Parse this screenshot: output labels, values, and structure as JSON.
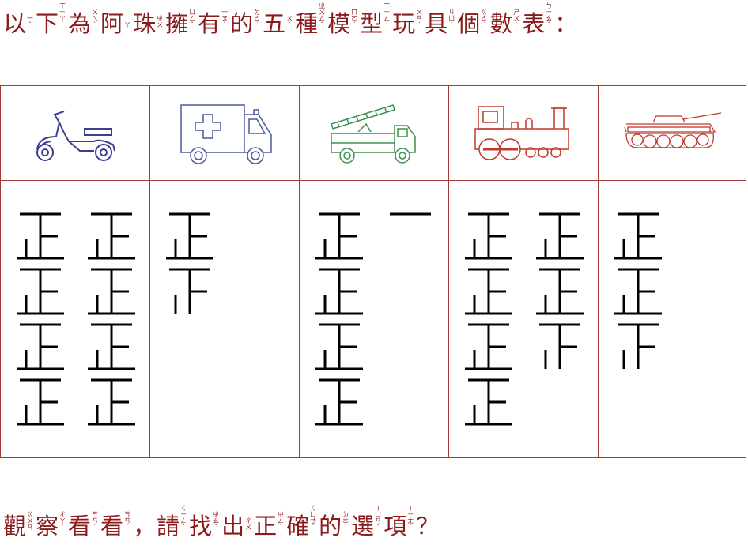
{
  "question_line": [
    {
      "char": "以",
      "bpmf": [
        "一",
        "ˇ"
      ]
    },
    {
      "char": "下",
      "bpmf": [
        "ㄒ",
        "ㄧ",
        "ㄚ",
        "ˋ"
      ]
    },
    {
      "char": "為",
      "bpmf": [
        "ㄨ",
        "ㄟ",
        "ˋ"
      ]
    },
    {
      "char": "阿",
      "bpmf": [
        "ㄚ"
      ]
    },
    {
      "char": "珠",
      "bpmf": [
        "ㄓ",
        "ㄨ"
      ]
    },
    {
      "char": "擁",
      "bpmf": [
        "ㄩ",
        "ㄥ",
        "ˇ"
      ]
    },
    {
      "char": "有",
      "bpmf": [
        "一",
        "ㄡ",
        "ˇ"
      ]
    },
    {
      "char": "的",
      "bpmf": [
        "ㄉ",
        "ㄜ",
        "˙"
      ]
    },
    {
      "char": "五",
      "bpmf": [
        "ㄨ",
        "ˇ"
      ]
    },
    {
      "char": "種",
      "bpmf": [
        "ㄓ",
        "ㄨ",
        "ㄥ",
        "ˇ"
      ]
    },
    {
      "char": "模",
      "bpmf": [
        "ㄇ",
        "ㄛ",
        "ˊ"
      ]
    },
    {
      "char": "型",
      "bpmf": [
        "ㄒ",
        "ㄧ",
        "ㄥ",
        "ˊ"
      ]
    },
    {
      "char": "玩",
      "bpmf": [
        "ㄨ",
        "ㄢ",
        "ˊ"
      ]
    },
    {
      "char": "具",
      "bpmf": [
        "ㄐ",
        "ㄩ",
        "ˋ"
      ]
    },
    {
      "char": "個",
      "bpmf": [
        "ㄍ",
        "ㄜ",
        "˙"
      ]
    },
    {
      "char": "數",
      "bpmf": [
        "ㄕ",
        "ㄨ",
        "ˋ"
      ]
    },
    {
      "char": "表",
      "bpmf": [
        "ㄅ",
        "ㄧ",
        "ㄠ",
        "ˇ"
      ]
    },
    {
      "char": "：",
      "bpmf": []
    }
  ],
  "prompt_line": [
    {
      "char": "觀",
      "bpmf": [
        "ㄍ",
        "ㄨ",
        "ㄢ"
      ]
    },
    {
      "char": "察",
      "bpmf": [
        "ㄔ",
        "ㄚ",
        "ˊ"
      ]
    },
    {
      "char": "看",
      "bpmf": [
        "ㄎ",
        "ㄢ",
        "ˋ"
      ]
    },
    {
      "char": "看",
      "bpmf": [
        "ㄎ",
        "ㄢ",
        "ˋ"
      ]
    },
    {
      "char": "，",
      "bpmf": []
    },
    {
      "char": "請",
      "bpmf": [
        "ㄑ",
        "ㄧ",
        "ㄥ",
        "ˇ"
      ]
    },
    {
      "char": "找",
      "bpmf": [
        "ㄓ",
        "ㄠ",
        "ˇ"
      ]
    },
    {
      "char": "出",
      "bpmf": [
        "ㄔ",
        "ㄨ"
      ]
    },
    {
      "char": "正",
      "bpmf": [
        "ㄓ",
        "ㄥ",
        "ˋ"
      ]
    },
    {
      "char": "確",
      "bpmf": [
        "ㄑ",
        "ㄩ",
        "ㄝ",
        "ˋ"
      ]
    },
    {
      "char": "的",
      "bpmf": [
        "ㄉ",
        "ㄜ",
        "˙"
      ]
    },
    {
      "char": "選",
      "bpmf": [
        "ㄒ",
        "ㄩ",
        "ㄢ",
        "ˇ"
      ]
    },
    {
      "char": "項",
      "bpmf": [
        "ㄒ",
        "ㄧ",
        "ㄤ",
        "ˋ"
      ]
    },
    {
      "char": "？",
      "bpmf": []
    }
  ],
  "toys": [
    {
      "icon": "scooter-icon",
      "color": "#3b3f8f",
      "tally_count": 40
    },
    {
      "icon": "ambulance-icon",
      "color": "#4a5a9a",
      "tally_count": 9
    },
    {
      "icon": "fire-truck-icon",
      "color": "#3f8f4f",
      "tally_count": 21
    },
    {
      "icon": "steam-train-icon",
      "color": "#c0392b",
      "tally_count": 34
    },
    {
      "icon": "tank-icon",
      "color": "#c0392b",
      "tally_count": 14
    }
  ],
  "colors": {
    "text": "#8b1a1a",
    "border": "#a33a3a",
    "tally": "#000000"
  }
}
